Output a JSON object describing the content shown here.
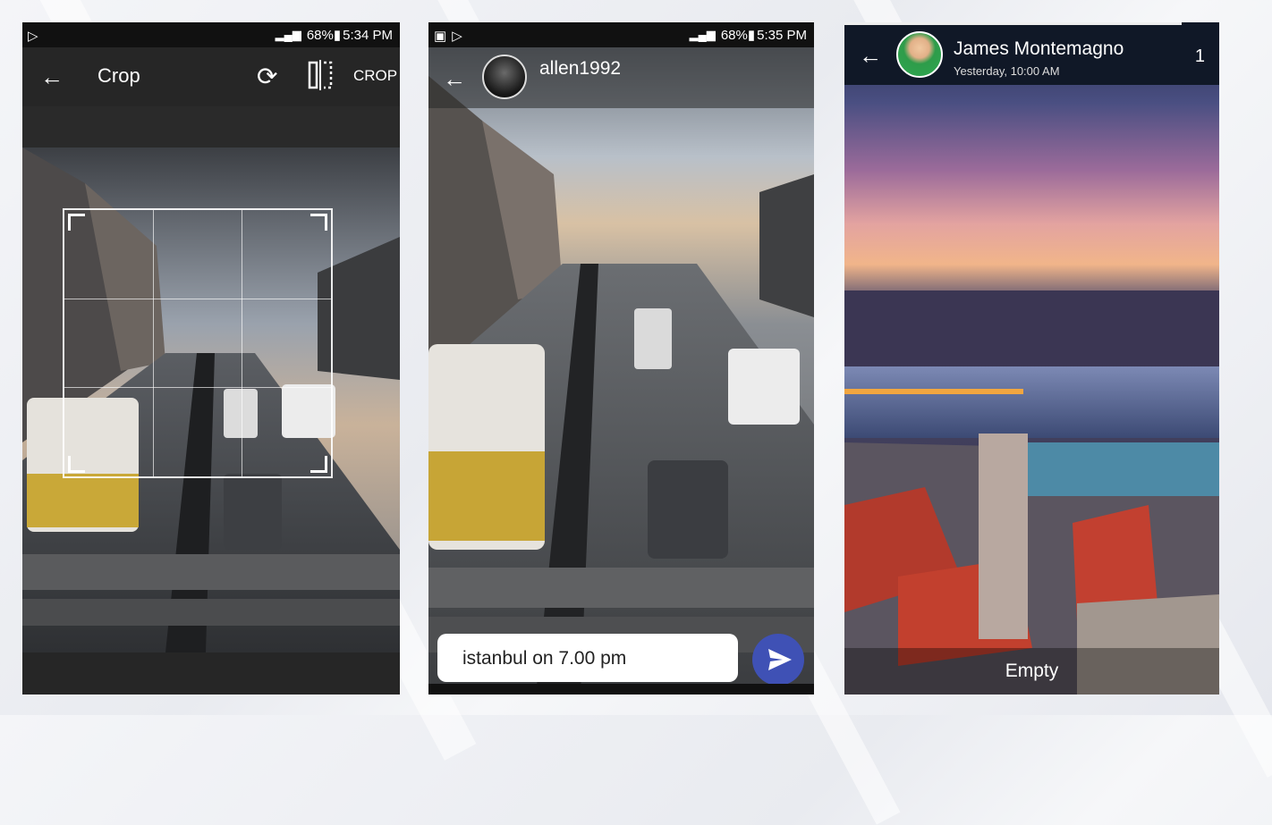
{
  "status_left": {
    "battery": "68%",
    "time": "5:34 PM"
  },
  "status_middle": {
    "battery": "68%",
    "time": "5:35 PM"
  },
  "crop_screen": {
    "title": "Crop",
    "crop_action": "CROP",
    "icons": {
      "back": "arrow-back-icon",
      "rotate": "rotate-icon",
      "flip": "flip-horizontal-icon"
    }
  },
  "chat_screen": {
    "contact_name": "allen1992",
    "input_value": "istanbul on 7.00 pm",
    "icons": {
      "back": "arrow-back-icon",
      "send": "send-icon"
    },
    "accent": "#3f51b5"
  },
  "story_screen": {
    "contact_name": "James Montemagno",
    "timestamp": "Yesterday, 10:00 AM",
    "count": "1",
    "caption": "Empty",
    "progress": 0.9
  }
}
